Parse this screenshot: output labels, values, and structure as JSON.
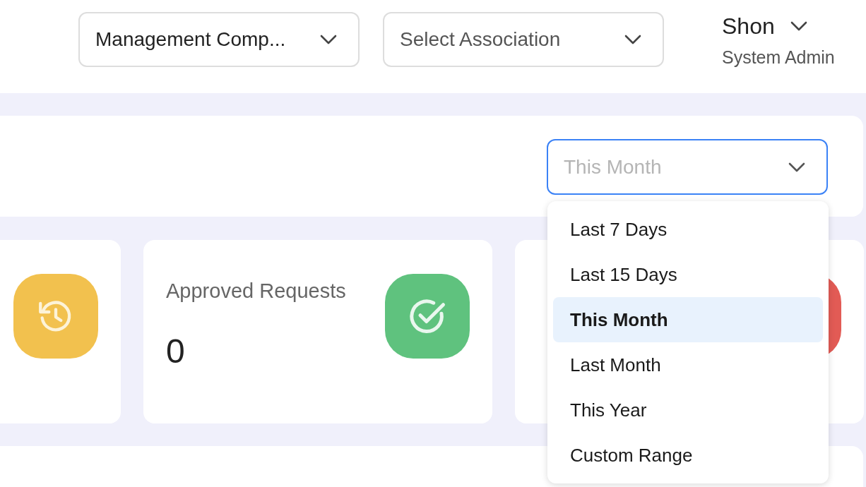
{
  "header": {
    "company_select": {
      "value": "Management Comp..."
    },
    "association_select": {
      "placeholder": "Select Association"
    },
    "user": {
      "name": "Shon",
      "role": "System Admin"
    }
  },
  "period_select": {
    "placeholder": "This Month",
    "open": true,
    "options": [
      {
        "label": "Last 7 Days",
        "selected": false
      },
      {
        "label": "Last 15 Days",
        "selected": false
      },
      {
        "label": "This Month",
        "selected": true
      },
      {
        "label": "Last Month",
        "selected": false
      },
      {
        "label": "This Year",
        "selected": false
      },
      {
        "label": "Custom Range",
        "selected": false
      }
    ]
  },
  "cards": [
    {
      "kind": "pending",
      "color": "#f2c14e"
    },
    {
      "kind": "approved",
      "title": "Approved Requests",
      "value": "0",
      "color": "#5fc27e"
    },
    {
      "kind": "declined",
      "color": "#e25b55"
    }
  ]
}
